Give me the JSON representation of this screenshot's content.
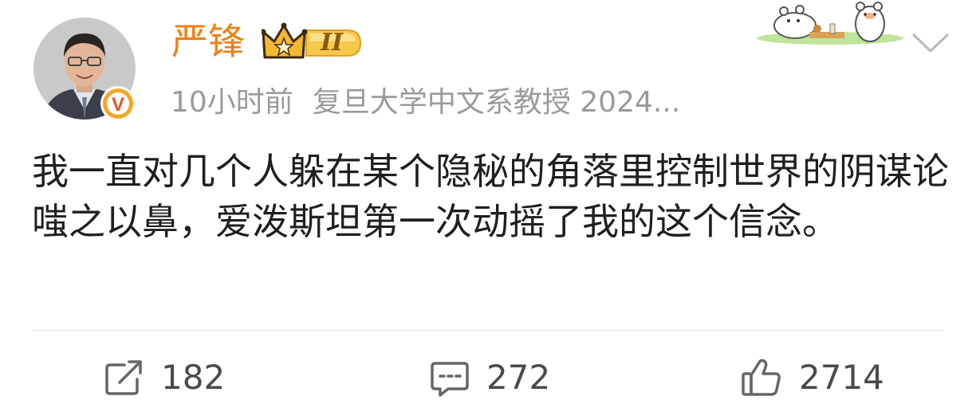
{
  "post": {
    "author": {
      "name": "严锋",
      "rank_badge_text": "II",
      "verified": true,
      "verified_badge_letter": "V"
    },
    "time": "10小时前",
    "source": "复旦大学中文系教授 2024...",
    "text": "我一直对几个人躲在某个隐秘的角落里控制世界的阴谋论嗤之以鼻，爱泼斯坦第一次动摇了我的这个信念。"
  },
  "actions": {
    "repost_count": "182",
    "comment_count": "272",
    "like_count": "2714"
  },
  "colors": {
    "username": "#f07f11",
    "verified_badge": "#f5a623",
    "meta_text": "#9a9a9a",
    "icon_gray": "#666666"
  },
  "icons": {
    "repost": "repost-icon",
    "comment": "comment-icon",
    "like": "thumbs-up-icon",
    "more": "chevron-down-icon",
    "decor": "bear-sticker-decoration"
  }
}
